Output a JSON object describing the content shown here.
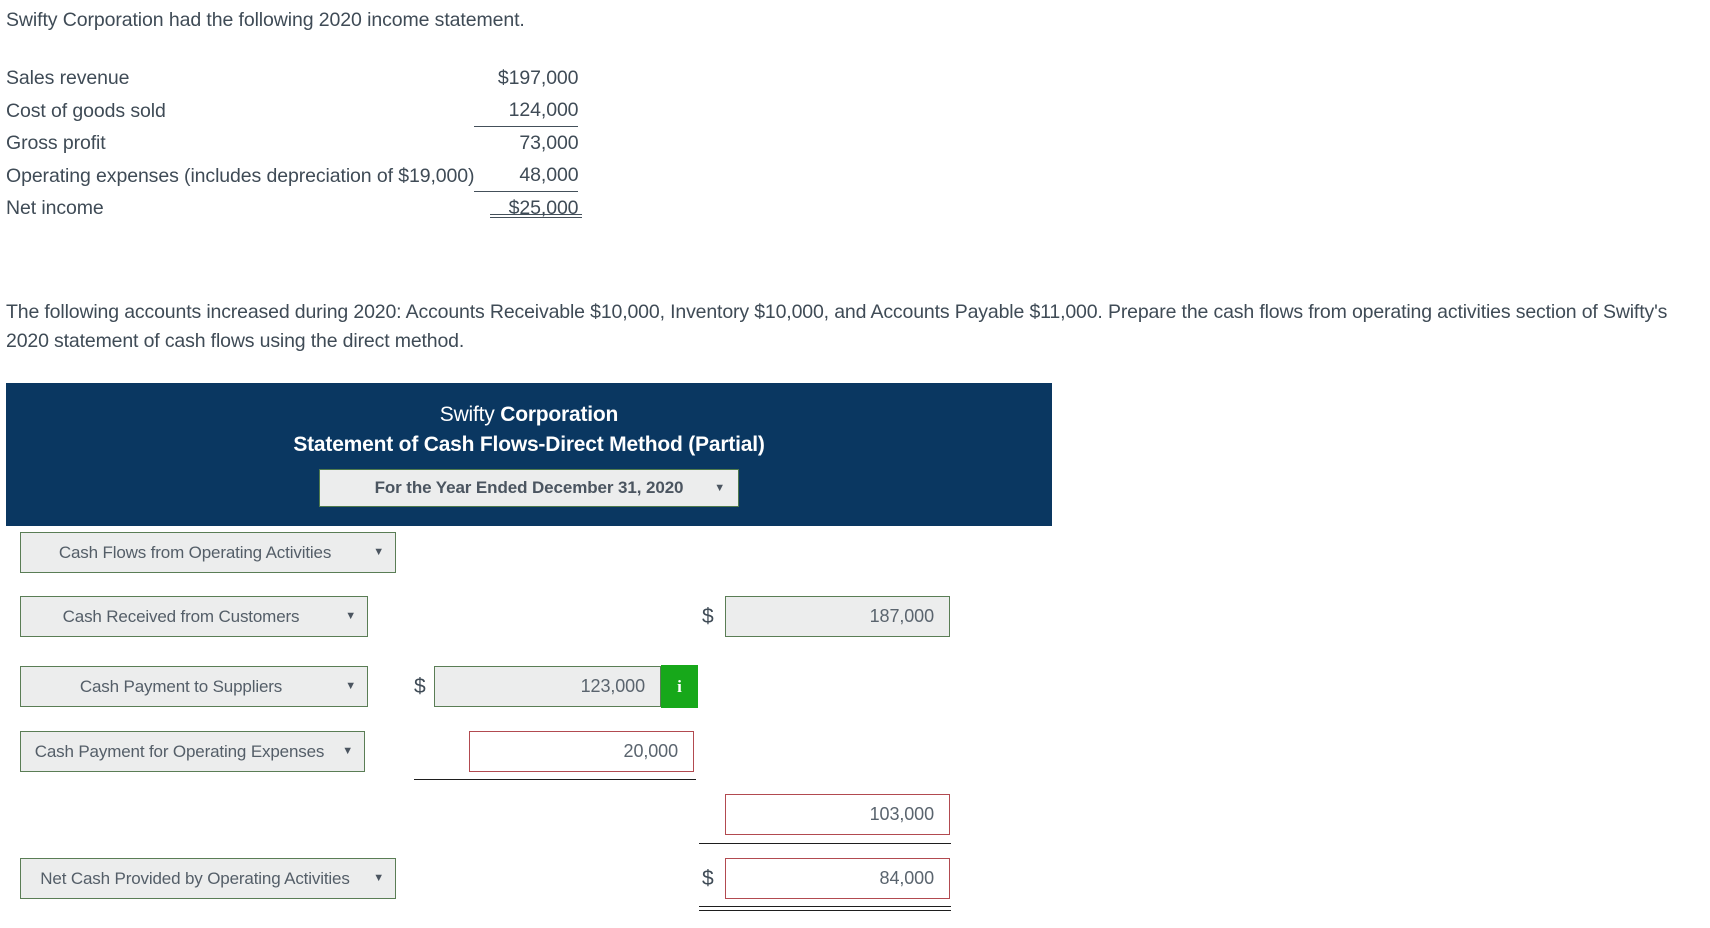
{
  "intro": {
    "text": "Swifty Corporation had the following 2020 income statement."
  },
  "income_statement": {
    "rows": [
      {
        "label": "Sales revenue",
        "amount": "$197,000"
      },
      {
        "label": "Cost of goods sold",
        "amount": "124,000"
      },
      {
        "label": "Gross profit",
        "amount": "73,000"
      },
      {
        "label": "Operating expenses (includes depreciation of $19,000)",
        "amount": "48,000"
      },
      {
        "label": "Net income",
        "amount": "$25,000"
      }
    ]
  },
  "prompt": {
    "text": "The following accounts increased during 2020: Accounts Receivable $10,000, Inventory $10,000, and Accounts Payable $11,000. Prepare the cash flows from operating activities section of Swifty's 2020 statement of cash flows using the direct method."
  },
  "worksheet": {
    "company_name_thin": "Swifty",
    "company_name_bold": "Corporation",
    "statement_title": "Statement of Cash Flows-Direct Method (Partial)",
    "period_select": {
      "value": "For the Year Ended December 31, 2020",
      "caret": "▼"
    },
    "rows": [
      {
        "account": "Cash Flows from Operating Activities",
        "caret": "▼"
      },
      {
        "account": "Cash Received from Customers",
        "caret": "▼",
        "dollar": "$",
        "amount": "187,000"
      },
      {
        "account": "Cash Payment to Suppliers",
        "caret": "▼",
        "dollar": "$",
        "amount": "123,000",
        "info": "i"
      },
      {
        "account": "Cash Payment for Operating Expenses",
        "caret": "▼",
        "amount": "20,000"
      },
      {
        "amount": "103,000"
      },
      {
        "account": "Net Cash Provided by Operating Activities",
        "caret": "▼",
        "dollar": "$",
        "amount": "84,000"
      }
    ]
  },
  "colors": {
    "header_blue": "#0a3761",
    "info_green": "#17a81a",
    "open_input_border": "#b24a50",
    "filled_input_border": "#5a7d55",
    "text": "#3f4b56"
  }
}
